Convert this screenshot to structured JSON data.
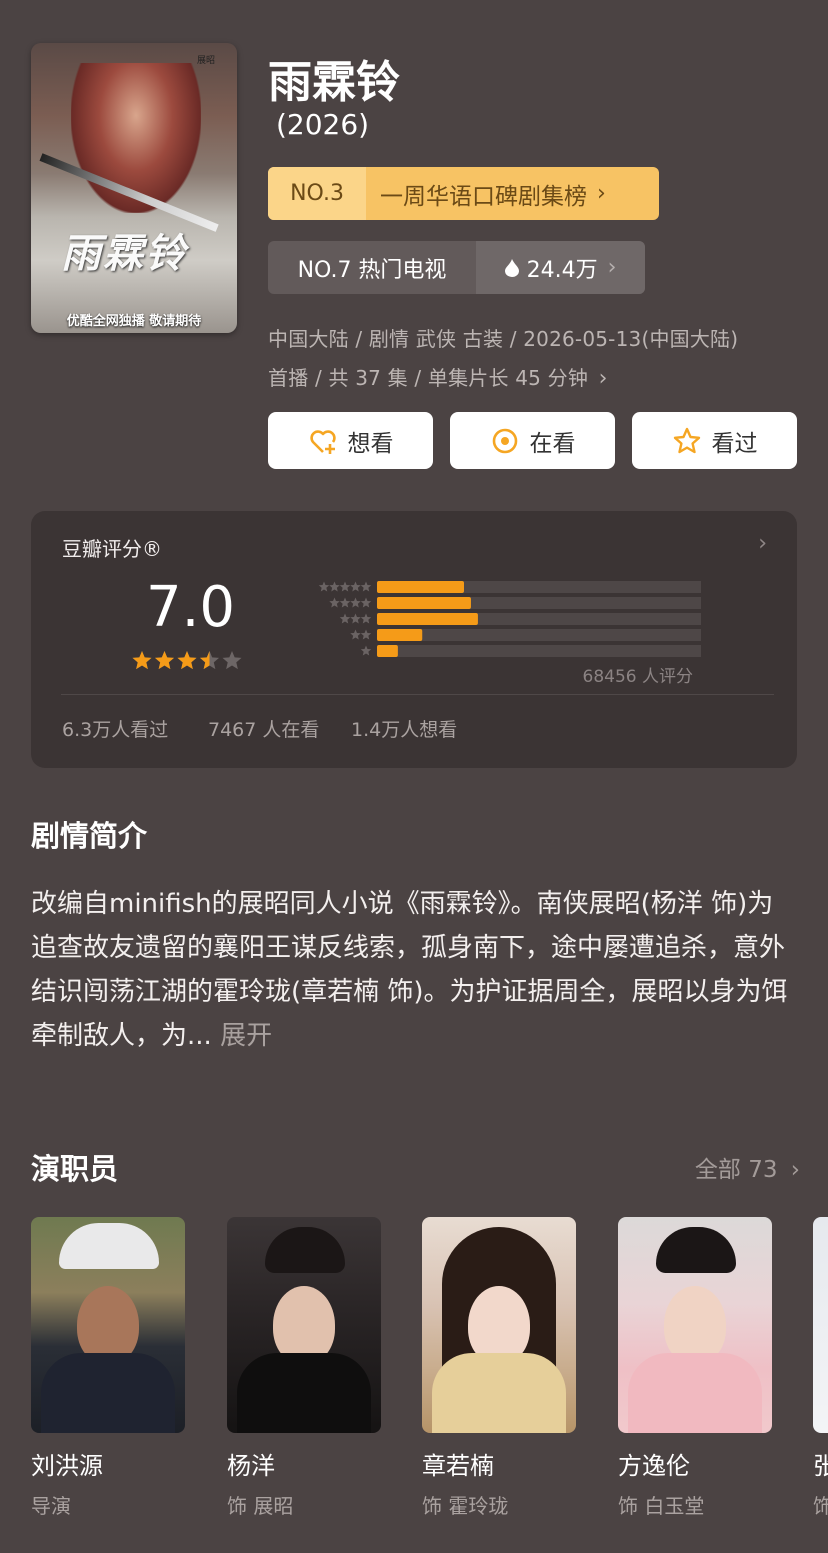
{
  "poster": {
    "calligraphy": "雨霖铃",
    "corner_text": "展昭",
    "footer": "优酷全网独播 敬请期待"
  },
  "title": "雨霖铃",
  "year": "(2026)",
  "rank_badge": {
    "no": "NO.3",
    "label": "一周华语口碑剧集榜"
  },
  "hot_badge": {
    "label": "NO.7 热门电视",
    "heat": "24.4万"
  },
  "meta": {
    "line1": "中国大陆 / 剧情 武侠 古装 / 2026-05-13(中国大陆)",
    "line2": "首播 / 共 37 集 / 单集片长 45 分钟"
  },
  "actions": [
    {
      "label": "想看",
      "icon": "heart-plus-icon"
    },
    {
      "label": "在看",
      "icon": "target-icon"
    },
    {
      "label": "看过",
      "icon": "star-outline-icon"
    }
  ],
  "rating": {
    "header": "豆瓣评分®",
    "score": "7.0",
    "stars_value": 3.5,
    "distribution": [
      {
        "stars": 5,
        "fraction": 0.25
      },
      {
        "stars": 4,
        "fraction": 0.27
      },
      {
        "stars": 3,
        "fraction": 0.29
      },
      {
        "stars": 2,
        "fraction": 0.13
      },
      {
        "stars": 1,
        "fraction": 0.06
      }
    ],
    "votes": "68456 人评分",
    "watched": "6.3万人看过",
    "watching": "7467 人在看",
    "want": "1.4万人想看"
  },
  "colors": {
    "accent_orange": "#f59b18",
    "star_empty": "#6d6666",
    "bar_track": "#4e4747"
  },
  "synopsis": {
    "heading": "剧情简介",
    "text": "改编自minifish的展昭同人小说《雨霖铃》。南侠展昭(杨洋 饰)为追查故友遗留的襄阳王谋反线索，孤身南下，途中屡遭追杀，意外结识闯荡江湖的霍玲珑(章若楠 饰)。为护证据周全，展昭以身为饵牵制敌人，为...",
    "more": "展开"
  },
  "cast": {
    "heading": "演职员",
    "all_label": "全部 73",
    "members": [
      {
        "name": "刘洪源",
        "role": "导演"
      },
      {
        "name": "杨洋",
        "role": "饰 展昭"
      },
      {
        "name": "章若楠",
        "role": "饰 霍玲珑"
      },
      {
        "name": "方逸伦",
        "role": "饰 白玉堂"
      },
      {
        "name": "张",
        "role": "饰"
      }
    ]
  }
}
